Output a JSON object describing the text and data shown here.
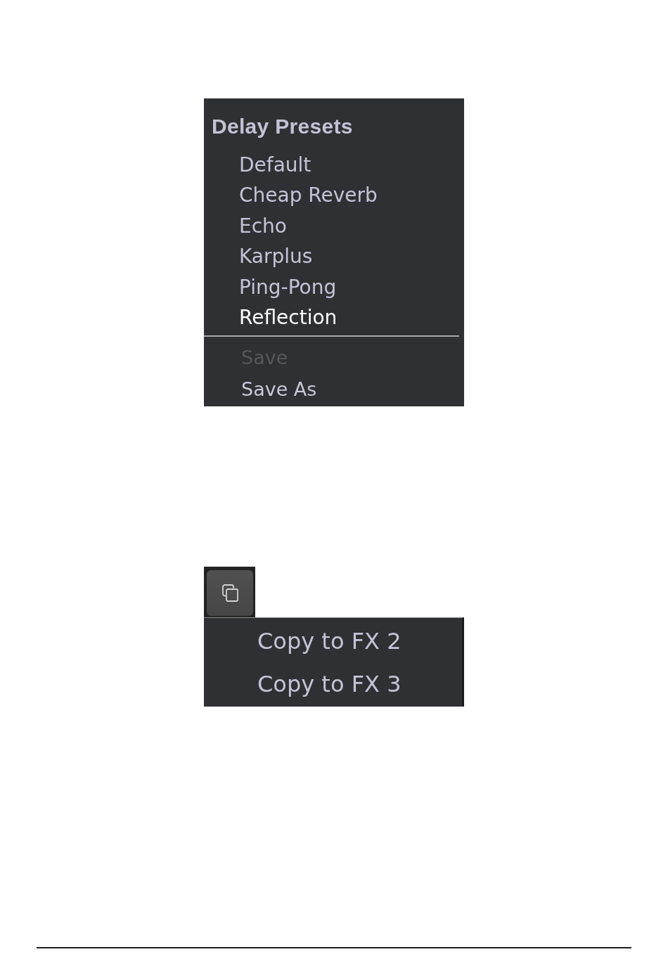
{
  "preset_menu": {
    "title": "Delay Presets",
    "items": [
      {
        "label": "Default",
        "selected": false
      },
      {
        "label": "Cheap Reverb",
        "selected": false
      },
      {
        "label": "Echo",
        "selected": false
      },
      {
        "label": "Karplus",
        "selected": false
      },
      {
        "label": "Ping-Pong",
        "selected": false
      },
      {
        "label": "Reflection",
        "selected": true
      }
    ],
    "actions": [
      {
        "label": "Save",
        "disabled": true
      },
      {
        "label": "Save As",
        "disabled": false
      }
    ]
  },
  "copy_menu": {
    "items": [
      {
        "label": "Copy to FX 2"
      },
      {
        "label": "Copy to FX 3"
      }
    ]
  }
}
